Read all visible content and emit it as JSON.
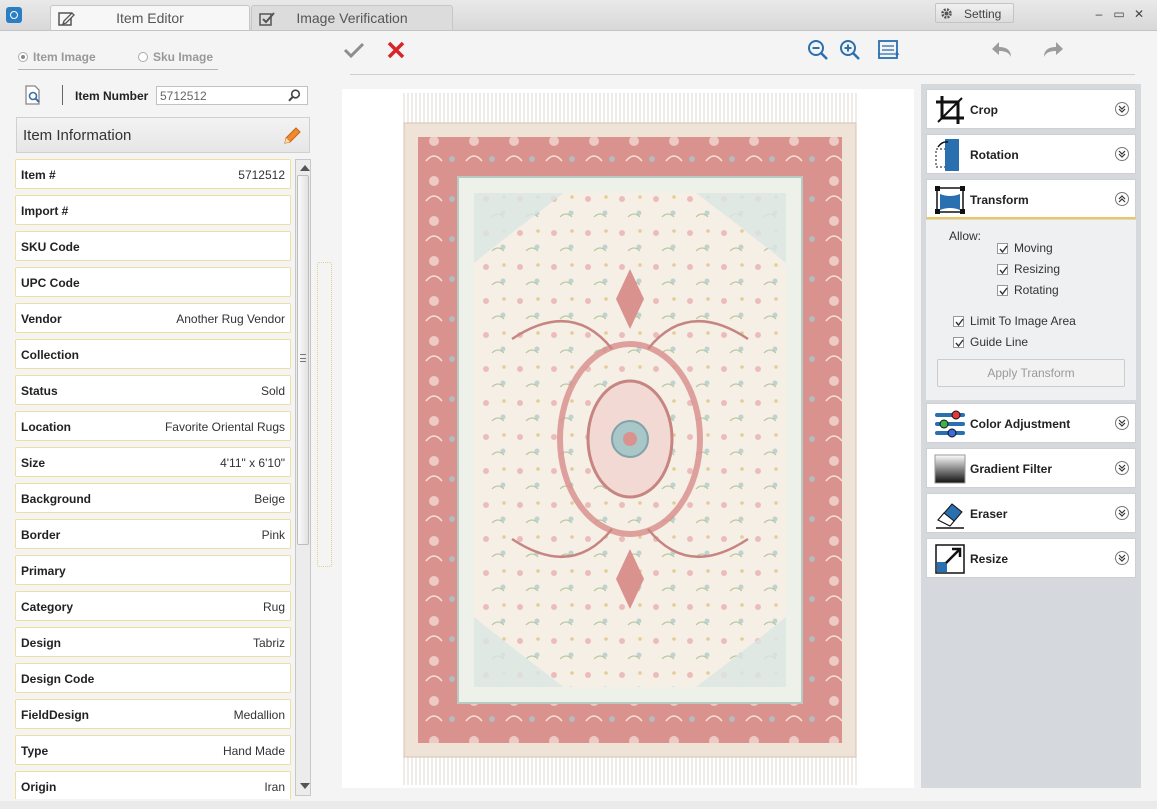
{
  "tabs": [
    {
      "label": "Item Editor",
      "icon": "edit-icon",
      "active": true
    },
    {
      "label": "Image Verification",
      "icon": "checkbox-icon",
      "active": false
    }
  ],
  "window": {
    "setting_label": "Setting"
  },
  "image_source": {
    "options": [
      "Item Image",
      "Sku Image"
    ],
    "selected": "Item Image"
  },
  "search": {
    "label": "Item Number",
    "value": "5712512"
  },
  "item_info": {
    "title": "Item Information"
  },
  "fields": [
    {
      "label": "Item #",
      "value": "5712512"
    },
    {
      "label": "Import #",
      "value": ""
    },
    {
      "label": "SKU Code",
      "value": ""
    },
    {
      "label": "UPC Code",
      "value": ""
    },
    {
      "label": "Vendor",
      "value": "Another Rug Vendor"
    },
    {
      "label": "Collection",
      "value": ""
    },
    {
      "label": "Status",
      "value": "Sold"
    },
    {
      "label": "Location",
      "value": "Favorite Oriental Rugs"
    },
    {
      "label": "Size",
      "value": "4'11\" x 6'10\""
    },
    {
      "label": "Background",
      "value": "Beige"
    },
    {
      "label": "Border",
      "value": "Pink"
    },
    {
      "label": "Primary",
      "value": ""
    },
    {
      "label": "Category",
      "value": "Rug"
    },
    {
      "label": "Design",
      "value": "Tabriz"
    },
    {
      "label": "Design Code",
      "value": ""
    },
    {
      "label": "FieldDesign",
      "value": "Medallion"
    },
    {
      "label": "Type",
      "value": "Hand Made"
    },
    {
      "label": "Origin",
      "value": "Iran"
    }
  ],
  "tools": [
    {
      "name": "Crop",
      "icon": "crop-icon",
      "expanded": false
    },
    {
      "name": "Rotation",
      "icon": "rotation-icon",
      "expanded": false
    },
    {
      "name": "Transform",
      "icon": "transform-icon",
      "expanded": true
    },
    {
      "name": "Color Adjustment",
      "icon": "color-adjustment-icon",
      "expanded": false
    },
    {
      "name": "Gradient Filter",
      "icon": "gradient-filter-icon",
      "expanded": false
    },
    {
      "name": "Eraser",
      "icon": "eraser-icon",
      "expanded": false
    },
    {
      "name": "Resize",
      "icon": "resize-icon",
      "expanded": false
    }
  ],
  "transform": {
    "allow_label": "Allow:",
    "options": [
      {
        "label": "Moving",
        "checked": true
      },
      {
        "label": "Resizing",
        "checked": true
      },
      {
        "label": "Rotating",
        "checked": true
      }
    ],
    "limit_label": "Limit To Image Area",
    "limit_checked": true,
    "guide_label": "Guide Line",
    "guide_checked": true,
    "apply_label": "Apply Transform"
  },
  "colors": {
    "accent": "#2a6fb0",
    "reject": "#d8232a",
    "field_border": "#f0de9c",
    "rug_border": "#d9928e",
    "rug_field": "#f6efe6"
  }
}
